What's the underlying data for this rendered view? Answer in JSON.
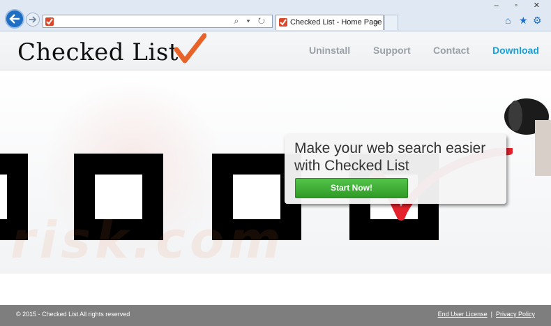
{
  "browser": {
    "tab_title": "Checked List - Home Page",
    "tab_close": "×",
    "address_tools": "⌕ ▾ ↻",
    "window_controls": "– ▫ ✕",
    "tools": {
      "home": "⌂",
      "favorites": "★",
      "settings": "⚙"
    }
  },
  "site": {
    "logo_text": "Checked List",
    "nav": {
      "uninstall": "Uninstall",
      "support": "Support",
      "contact": "Contact",
      "download": "Download"
    },
    "hero": {
      "headline_line1": "Make your web search easier",
      "headline_line2": "with Checked List",
      "cta_label": "Start Now!"
    },
    "watermark": "risk.com",
    "footer": {
      "copyright": "© 2015 - Checked List All rights reserved",
      "eula": "End User License",
      "separator": "|",
      "privacy": "Privacy Policy"
    }
  },
  "colors": {
    "accent_blue": "#1a9fd9",
    "cta_green": "#3aab30",
    "check_orange": "#e8632a",
    "footer_gray": "#7e7e7e"
  }
}
